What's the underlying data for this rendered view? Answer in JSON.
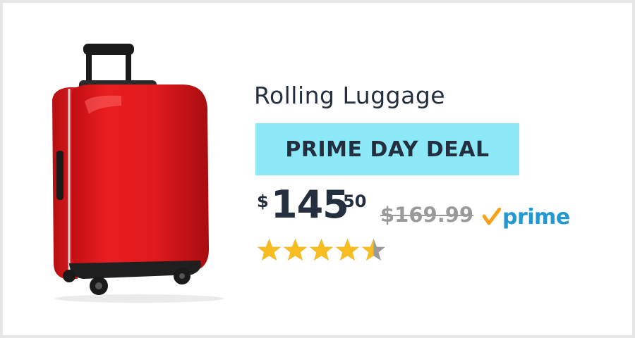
{
  "product": {
    "title": "Rolling Luggage",
    "image_icon": "red-rolling-suitcase",
    "colors": {
      "suitcase": "#e0191c",
      "suitcase_shadow": "#a80d10",
      "wheels": "#1a1a1a"
    }
  },
  "deal": {
    "badge_label": "PRIME DAY DEAL",
    "badge_color": "#8de8f7"
  },
  "price": {
    "currency": "$",
    "whole": "145",
    "fraction": "50",
    "list_price": "$169.99"
  },
  "prime": {
    "label": "prime",
    "icon": "checkmark-icon",
    "check_color": "#f7a21b",
    "text_color": "#2299d3"
  },
  "rating": {
    "stars": 4.5,
    "max": 5,
    "star_color": "#f7bd20",
    "empty_color": "#9a9a9a"
  }
}
